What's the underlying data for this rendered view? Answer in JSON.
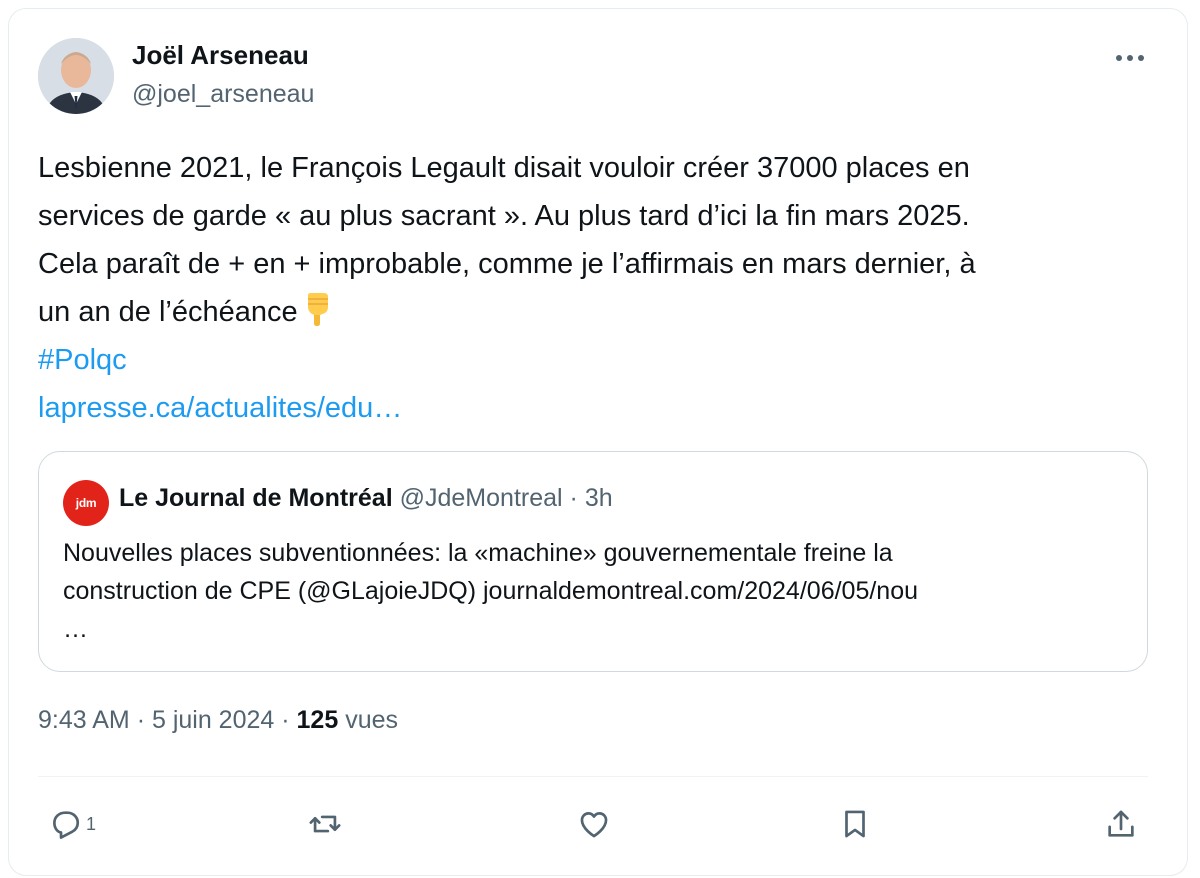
{
  "author": {
    "name": "Joël Arseneau",
    "handle": "@joel_arseneau"
  },
  "tweet": {
    "lines": [
      "Lesbienne 2021, le François Legault disait vouloir créer 37000 places en",
      "services de garde « au plus sacrant ». Au plus tard d’ici la fin mars 2025.",
      "Cela paraît de + en + improbable, comme je l’affirmais en mars dernier, à",
      "un an de l’échéance"
    ],
    "emoji": "backhand-index-pointing-down-icon",
    "hashtag": "#Polqc",
    "link": "lapresse.ca/actualites/edu…"
  },
  "quote": {
    "logo_text": "jdm",
    "name": "Le Journal de Montréal",
    "handle": "@JdeMontreal",
    "separator": "·",
    "time": "3h",
    "lines": [
      "Nouvelles places subventionnées: la «machine» gouvernementale freine la",
      "construction de CPE (@GLajoieJDQ) journaldemontreal.com/2024/06/05/nou",
      "…"
    ]
  },
  "meta": {
    "time": "9:43 AM",
    "sep1": "·",
    "date": "5 juin 2024",
    "sep2": "·",
    "views_count": "125",
    "views_label": "vues"
  },
  "actions": {
    "reply_count": "1"
  },
  "colors": {
    "link": "#1d9bf0",
    "secondary_text": "#536471",
    "border": "#cfd9de",
    "jdm_red": "#e2231a"
  }
}
